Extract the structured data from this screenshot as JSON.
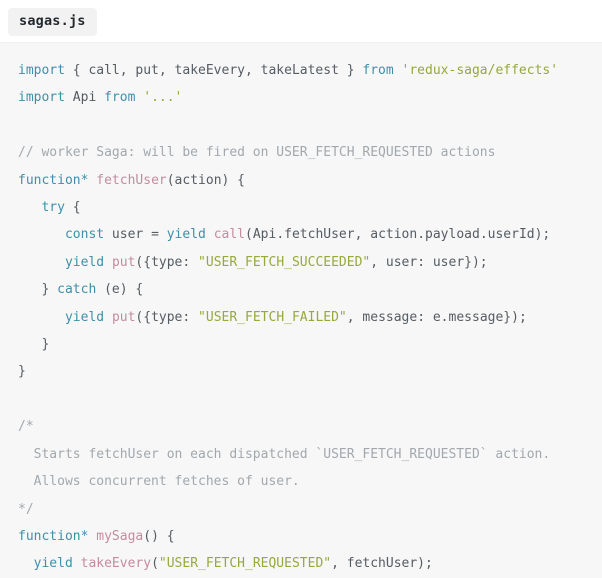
{
  "tab": {
    "filename": "sagas.js"
  },
  "code": {
    "language": "javascript",
    "lines": [
      {
        "id": 1,
        "text": "import { call, put, takeEvery, takeLatest } from 'redux-saga/effects'",
        "tokens": [
          {
            "t": "import",
            "c": "kw"
          },
          {
            "t": " { call, put, takeEvery, takeLatest } ",
            "c": "plain"
          },
          {
            "t": "from",
            "c": "kw"
          },
          {
            "t": " ",
            "c": "plain"
          },
          {
            "t": "'redux-saga/effects'",
            "c": "str"
          }
        ]
      },
      {
        "id": 2,
        "text": "import Api from '...'",
        "tokens": [
          {
            "t": "import",
            "c": "kw"
          },
          {
            "t": " Api ",
            "c": "plain"
          },
          {
            "t": "from",
            "c": "kw"
          },
          {
            "t": " ",
            "c": "plain"
          },
          {
            "t": "'...'",
            "c": "str"
          }
        ]
      },
      {
        "id": 3,
        "text": "",
        "tokens": []
      },
      {
        "id": 4,
        "text": "// worker Saga: will be fired on USER_FETCH_REQUESTED actions",
        "tokens": [
          {
            "t": "// worker Saga: will be fired on USER_FETCH_REQUESTED actions",
            "c": "cmt"
          }
        ]
      },
      {
        "id": 5,
        "text": "function* fetchUser(action) {",
        "tokens": [
          {
            "t": "function*",
            "c": "kw"
          },
          {
            "t": " ",
            "c": "plain"
          },
          {
            "t": "fetchUser",
            "c": "fn"
          },
          {
            "t": "(action) {",
            "c": "plain"
          }
        ]
      },
      {
        "id": 6,
        "text": "   try {",
        "tokens": [
          {
            "t": "   ",
            "c": "plain"
          },
          {
            "t": "try",
            "c": "kw"
          },
          {
            "t": " {",
            "c": "plain"
          }
        ]
      },
      {
        "id": 7,
        "text": "      const user = yield call(Api.fetchUser, action.payload.userId);",
        "tokens": [
          {
            "t": "      ",
            "c": "plain"
          },
          {
            "t": "const",
            "c": "kw"
          },
          {
            "t": " user = ",
            "c": "plain"
          },
          {
            "t": "yield",
            "c": "kw"
          },
          {
            "t": " ",
            "c": "plain"
          },
          {
            "t": "call",
            "c": "fn"
          },
          {
            "t": "(Api.fetchUser, action.payload.userId);",
            "c": "plain"
          }
        ]
      },
      {
        "id": 8,
        "text": "      yield put({type: \"USER_FETCH_SUCCEEDED\", user: user});",
        "tokens": [
          {
            "t": "      ",
            "c": "plain"
          },
          {
            "t": "yield",
            "c": "kw"
          },
          {
            "t": " ",
            "c": "plain"
          },
          {
            "t": "put",
            "c": "fn"
          },
          {
            "t": "({type: ",
            "c": "plain"
          },
          {
            "t": "\"USER_FETCH_SUCCEEDED\"",
            "c": "str"
          },
          {
            "t": ", user: user});",
            "c": "plain"
          }
        ]
      },
      {
        "id": 9,
        "text": "   } catch (e) {",
        "tokens": [
          {
            "t": "   } ",
            "c": "plain"
          },
          {
            "t": "catch",
            "c": "kw"
          },
          {
            "t": " (e) {",
            "c": "plain"
          }
        ]
      },
      {
        "id": 10,
        "text": "      yield put({type: \"USER_FETCH_FAILED\", message: e.message});",
        "tokens": [
          {
            "t": "      ",
            "c": "plain"
          },
          {
            "t": "yield",
            "c": "kw"
          },
          {
            "t": " ",
            "c": "plain"
          },
          {
            "t": "put",
            "c": "fn"
          },
          {
            "t": "({type: ",
            "c": "plain"
          },
          {
            "t": "\"USER_FETCH_FAILED\"",
            "c": "str"
          },
          {
            "t": ", message: e.message});",
            "c": "plain"
          }
        ]
      },
      {
        "id": 11,
        "text": "   }",
        "tokens": [
          {
            "t": "   }",
            "c": "plain"
          }
        ]
      },
      {
        "id": 12,
        "text": "}",
        "tokens": [
          {
            "t": "}",
            "c": "plain"
          }
        ]
      },
      {
        "id": 13,
        "text": "",
        "tokens": []
      },
      {
        "id": 14,
        "text": "/*",
        "tokens": [
          {
            "t": "/*",
            "c": "cmt"
          }
        ]
      },
      {
        "id": 15,
        "text": "  Starts fetchUser on each dispatched `USER_FETCH_REQUESTED` action.",
        "tokens": [
          {
            "t": "  Starts fetchUser on each dispatched `USER_FETCH_REQUESTED` action.",
            "c": "cmt"
          }
        ]
      },
      {
        "id": 16,
        "text": "  Allows concurrent fetches of user.",
        "tokens": [
          {
            "t": "  Allows concurrent fetches of user.",
            "c": "cmt"
          }
        ]
      },
      {
        "id": 17,
        "text": "*/",
        "tokens": [
          {
            "t": "*/",
            "c": "cmt"
          }
        ]
      },
      {
        "id": 18,
        "text": "function* mySaga() {",
        "tokens": [
          {
            "t": "function*",
            "c": "kw"
          },
          {
            "t": " ",
            "c": "plain"
          },
          {
            "t": "mySaga",
            "c": "fn"
          },
          {
            "t": "() {",
            "c": "plain"
          }
        ]
      },
      {
        "id": 19,
        "text": "  yield takeEvery(\"USER_FETCH_REQUESTED\", fetchUser);",
        "tokens": [
          {
            "t": "  ",
            "c": "plain"
          },
          {
            "t": "yield",
            "c": "kw"
          },
          {
            "t": " ",
            "c": "plain"
          },
          {
            "t": "takeEvery",
            "c": "fn"
          },
          {
            "t": "(",
            "c": "plain"
          },
          {
            "t": "\"USER_FETCH_REQUESTED\"",
            "c": "str"
          },
          {
            "t": ", fetchUser);",
            "c": "plain"
          }
        ]
      }
    ]
  },
  "colors": {
    "background": "#ffffff",
    "code_background": "#f7f7f7",
    "tab_background": "#f2f2f2",
    "tab_text": "#24292e",
    "keyword": "#3f8faa",
    "function": "#c48c9f",
    "string": "#97a83c",
    "comment": "#a2a8ad",
    "plain": "#555c63"
  }
}
